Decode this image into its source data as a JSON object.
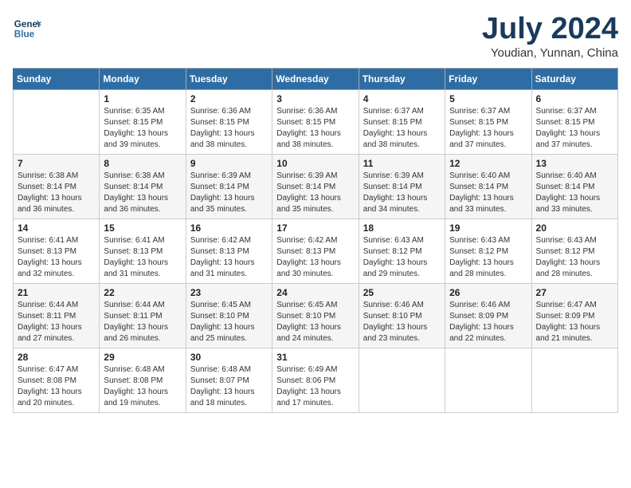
{
  "header": {
    "logo_line1": "General",
    "logo_line2": "Blue",
    "month_title": "July 2024",
    "subtitle": "Youdian, Yunnan, China"
  },
  "weekdays": [
    "Sunday",
    "Monday",
    "Tuesday",
    "Wednesday",
    "Thursday",
    "Friday",
    "Saturday"
  ],
  "weeks": [
    [
      {
        "day": "",
        "sunrise": "",
        "sunset": "",
        "daylight": ""
      },
      {
        "day": "1",
        "sunrise": "Sunrise: 6:35 AM",
        "sunset": "Sunset: 8:15 PM",
        "daylight": "Daylight: 13 hours and 39 minutes."
      },
      {
        "day": "2",
        "sunrise": "Sunrise: 6:36 AM",
        "sunset": "Sunset: 8:15 PM",
        "daylight": "Daylight: 13 hours and 38 minutes."
      },
      {
        "day": "3",
        "sunrise": "Sunrise: 6:36 AM",
        "sunset": "Sunset: 8:15 PM",
        "daylight": "Daylight: 13 hours and 38 minutes."
      },
      {
        "day": "4",
        "sunrise": "Sunrise: 6:37 AM",
        "sunset": "Sunset: 8:15 PM",
        "daylight": "Daylight: 13 hours and 38 minutes."
      },
      {
        "day": "5",
        "sunrise": "Sunrise: 6:37 AM",
        "sunset": "Sunset: 8:15 PM",
        "daylight": "Daylight: 13 hours and 37 minutes."
      },
      {
        "day": "6",
        "sunrise": "Sunrise: 6:37 AM",
        "sunset": "Sunset: 8:15 PM",
        "daylight": "Daylight: 13 hours and 37 minutes."
      }
    ],
    [
      {
        "day": "7",
        "sunrise": "Sunrise: 6:38 AM",
        "sunset": "Sunset: 8:14 PM",
        "daylight": "Daylight: 13 hours and 36 minutes."
      },
      {
        "day": "8",
        "sunrise": "Sunrise: 6:38 AM",
        "sunset": "Sunset: 8:14 PM",
        "daylight": "Daylight: 13 hours and 36 minutes."
      },
      {
        "day": "9",
        "sunrise": "Sunrise: 6:39 AM",
        "sunset": "Sunset: 8:14 PM",
        "daylight": "Daylight: 13 hours and 35 minutes."
      },
      {
        "day": "10",
        "sunrise": "Sunrise: 6:39 AM",
        "sunset": "Sunset: 8:14 PM",
        "daylight": "Daylight: 13 hours and 35 minutes."
      },
      {
        "day": "11",
        "sunrise": "Sunrise: 6:39 AM",
        "sunset": "Sunset: 8:14 PM",
        "daylight": "Daylight: 13 hours and 34 minutes."
      },
      {
        "day": "12",
        "sunrise": "Sunrise: 6:40 AM",
        "sunset": "Sunset: 8:14 PM",
        "daylight": "Daylight: 13 hours and 33 minutes."
      },
      {
        "day": "13",
        "sunrise": "Sunrise: 6:40 AM",
        "sunset": "Sunset: 8:14 PM",
        "daylight": "Daylight: 13 hours and 33 minutes."
      }
    ],
    [
      {
        "day": "14",
        "sunrise": "Sunrise: 6:41 AM",
        "sunset": "Sunset: 8:13 PM",
        "daylight": "Daylight: 13 hours and 32 minutes."
      },
      {
        "day": "15",
        "sunrise": "Sunrise: 6:41 AM",
        "sunset": "Sunset: 8:13 PM",
        "daylight": "Daylight: 13 hours and 31 minutes."
      },
      {
        "day": "16",
        "sunrise": "Sunrise: 6:42 AM",
        "sunset": "Sunset: 8:13 PM",
        "daylight": "Daylight: 13 hours and 31 minutes."
      },
      {
        "day": "17",
        "sunrise": "Sunrise: 6:42 AM",
        "sunset": "Sunset: 8:13 PM",
        "daylight": "Daylight: 13 hours and 30 minutes."
      },
      {
        "day": "18",
        "sunrise": "Sunrise: 6:43 AM",
        "sunset": "Sunset: 8:12 PM",
        "daylight": "Daylight: 13 hours and 29 minutes."
      },
      {
        "day": "19",
        "sunrise": "Sunrise: 6:43 AM",
        "sunset": "Sunset: 8:12 PM",
        "daylight": "Daylight: 13 hours and 28 minutes."
      },
      {
        "day": "20",
        "sunrise": "Sunrise: 6:43 AM",
        "sunset": "Sunset: 8:12 PM",
        "daylight": "Daylight: 13 hours and 28 minutes."
      }
    ],
    [
      {
        "day": "21",
        "sunrise": "Sunrise: 6:44 AM",
        "sunset": "Sunset: 8:11 PM",
        "daylight": "Daylight: 13 hours and 27 minutes."
      },
      {
        "day": "22",
        "sunrise": "Sunrise: 6:44 AM",
        "sunset": "Sunset: 8:11 PM",
        "daylight": "Daylight: 13 hours and 26 minutes."
      },
      {
        "day": "23",
        "sunrise": "Sunrise: 6:45 AM",
        "sunset": "Sunset: 8:10 PM",
        "daylight": "Daylight: 13 hours and 25 minutes."
      },
      {
        "day": "24",
        "sunrise": "Sunrise: 6:45 AM",
        "sunset": "Sunset: 8:10 PM",
        "daylight": "Daylight: 13 hours and 24 minutes."
      },
      {
        "day": "25",
        "sunrise": "Sunrise: 6:46 AM",
        "sunset": "Sunset: 8:10 PM",
        "daylight": "Daylight: 13 hours and 23 minutes."
      },
      {
        "day": "26",
        "sunrise": "Sunrise: 6:46 AM",
        "sunset": "Sunset: 8:09 PM",
        "daylight": "Daylight: 13 hours and 22 minutes."
      },
      {
        "day": "27",
        "sunrise": "Sunrise: 6:47 AM",
        "sunset": "Sunset: 8:09 PM",
        "daylight": "Daylight: 13 hours and 21 minutes."
      }
    ],
    [
      {
        "day": "28",
        "sunrise": "Sunrise: 6:47 AM",
        "sunset": "Sunset: 8:08 PM",
        "daylight": "Daylight: 13 hours and 20 minutes."
      },
      {
        "day": "29",
        "sunrise": "Sunrise: 6:48 AM",
        "sunset": "Sunset: 8:08 PM",
        "daylight": "Daylight: 13 hours and 19 minutes."
      },
      {
        "day": "30",
        "sunrise": "Sunrise: 6:48 AM",
        "sunset": "Sunset: 8:07 PM",
        "daylight": "Daylight: 13 hours and 18 minutes."
      },
      {
        "day": "31",
        "sunrise": "Sunrise: 6:49 AM",
        "sunset": "Sunset: 8:06 PM",
        "daylight": "Daylight: 13 hours and 17 minutes."
      },
      {
        "day": "",
        "sunrise": "",
        "sunset": "",
        "daylight": ""
      },
      {
        "day": "",
        "sunrise": "",
        "sunset": "",
        "daylight": ""
      },
      {
        "day": "",
        "sunrise": "",
        "sunset": "",
        "daylight": ""
      }
    ]
  ]
}
